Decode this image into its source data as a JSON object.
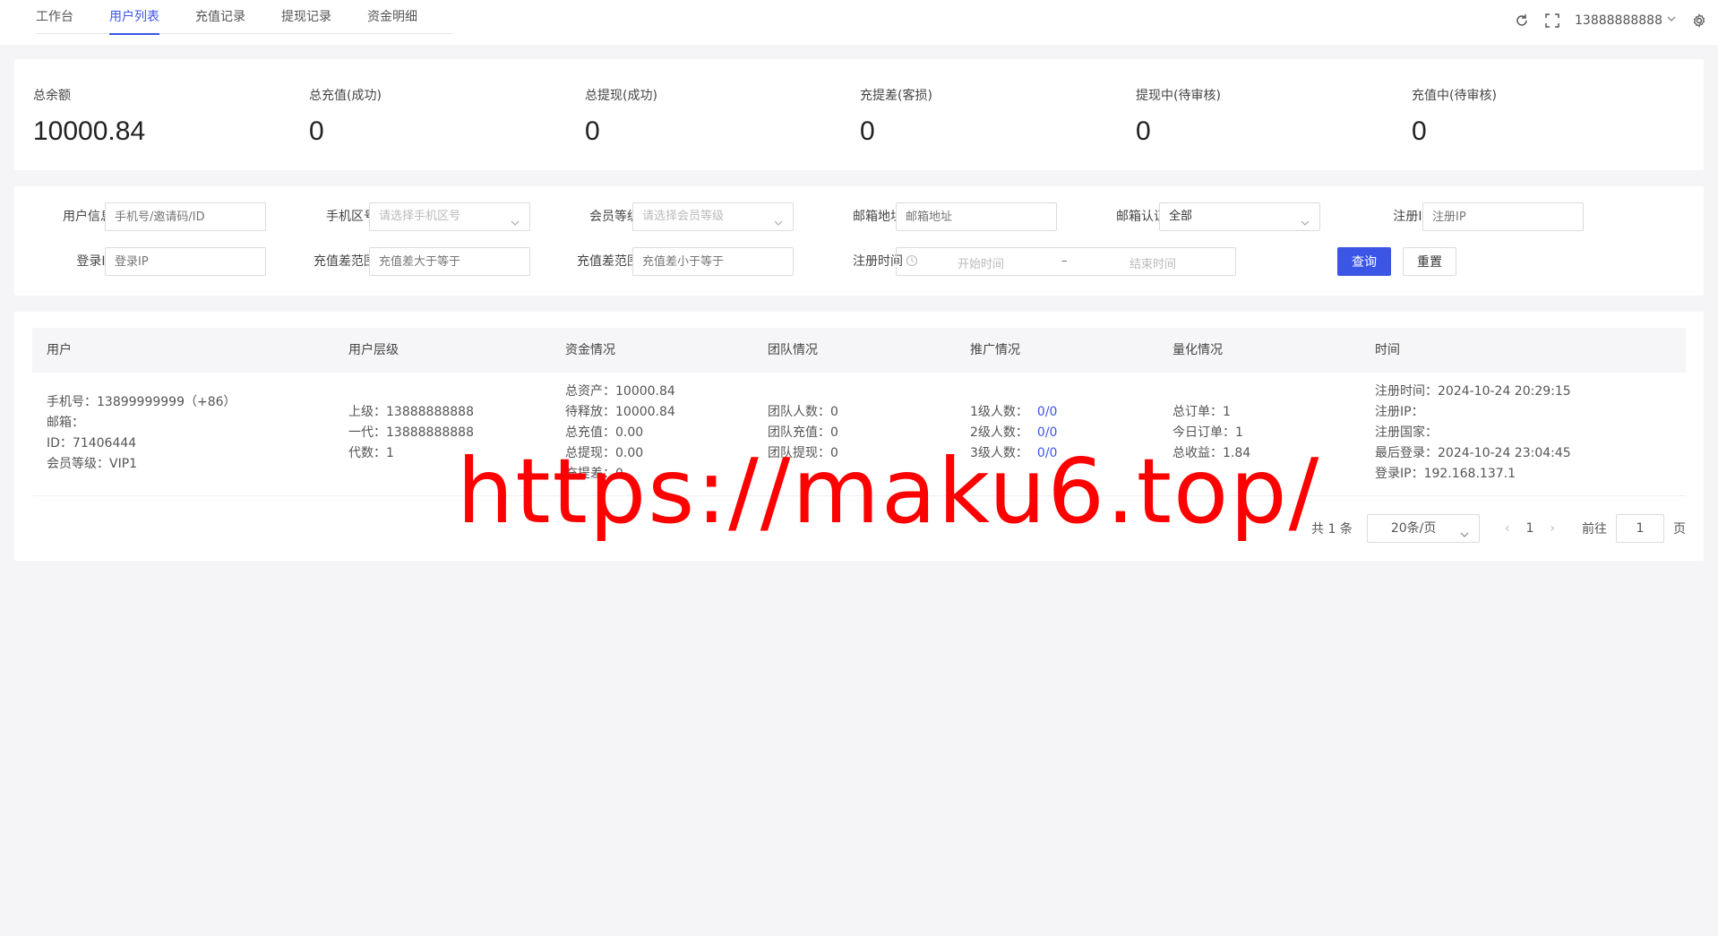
{
  "tabs": [
    {
      "label": "工作台"
    },
    {
      "label": "用户列表",
      "active": true
    },
    {
      "label": "充值记录"
    },
    {
      "label": "提现记录"
    },
    {
      "label": "资金明细"
    }
  ],
  "header": {
    "username": "13888888888",
    "icons": [
      "refresh-icon",
      "fullscreen-icon",
      "chevron-down-icon",
      "gear-icon"
    ]
  },
  "stats": [
    {
      "label": "总余额",
      "value": "10000.84"
    },
    {
      "label": "总充值(成功)",
      "value": "0"
    },
    {
      "label": "总提现(成功)",
      "value": "0"
    },
    {
      "label": "充提差(客损)",
      "value": "0"
    },
    {
      "label": "提现中(待审核)",
      "value": "0"
    },
    {
      "label": "充值中(待审核)",
      "value": "0"
    }
  ],
  "filters": {
    "user_info": {
      "label": "用户信息",
      "placeholder": "手机号/邀请码/ID"
    },
    "phone_region": {
      "label": "手机区号",
      "placeholder": "请选择手机区号"
    },
    "member_level": {
      "label": "会员等级",
      "placeholder": "请选择会员等级"
    },
    "email": {
      "label": "邮箱地址",
      "placeholder": "邮箱地址"
    },
    "email_verify": {
      "label": "邮箱认证",
      "value": "全部"
    },
    "register_ip": {
      "label": "注册IP",
      "placeholder": "注册IP"
    },
    "login_ip": {
      "label": "登录IP",
      "placeholder": "登录IP"
    },
    "diff_min": {
      "label": "充值差范围",
      "placeholder": "充值差大于等于"
    },
    "diff_max": {
      "label": "充值差范围",
      "placeholder": "充值差小于等于"
    },
    "register_time": {
      "label": "注册时间",
      "start": "开始时间",
      "sep": "–",
      "end": "结束时间"
    },
    "query_label": "查询",
    "reset_label": "重置"
  },
  "table": {
    "columns": [
      "用户",
      "用户层级",
      "资金情况",
      "团队情况",
      "推广情况",
      "量化情况",
      "时间"
    ],
    "row": {
      "user": [
        "手机号：13899999999（+86）",
        "邮箱：",
        "ID：71406444",
        "会员等级：VIP1"
      ],
      "level": [
        "上级：13888888888",
        "一代：13888888888",
        "代数：1"
      ],
      "funds": [
        "总资产：10000.84",
        "待释放：10000.84",
        "总充值：0.00",
        "总提现：0.00",
        "充提差：0"
      ],
      "team": [
        "团队人数：0",
        "团队充值：0",
        "团队提现：0"
      ],
      "promo": [
        {
          "label": "1级人数：",
          "value": "0/0"
        },
        {
          "label": "2级人数：",
          "value": "0/0"
        },
        {
          "label": "3级人数：",
          "value": "0/0"
        }
      ],
      "quant": [
        "总订单：1",
        "今日订单：1",
        "总收益：1.84"
      ],
      "time": [
        "注册时间：2024-10-24 20:29:15",
        "注册IP：",
        "注册国家：",
        "最后登录：2024-10-24 23:04:45",
        "登录IP：192.168.137.1"
      ]
    }
  },
  "pagination": {
    "total": "共 1 条",
    "page_size": "20条/页",
    "current": "1",
    "goto_label": "前往",
    "goto_value": "1",
    "page_suffix": "页"
  },
  "watermark": "https://maku6.top/"
}
